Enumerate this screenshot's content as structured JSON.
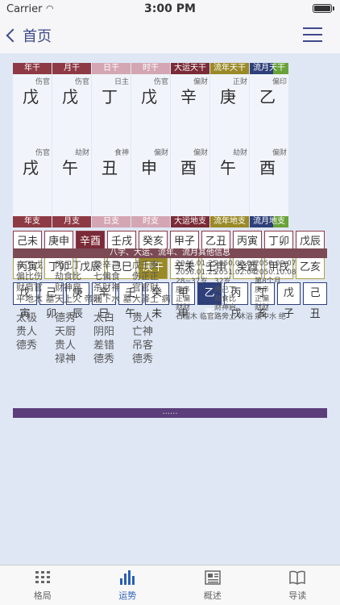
{
  "status": {
    "carrier": "Carrier",
    "time": "3:00 PM"
  },
  "nav": {
    "back_label": "首页"
  },
  "headers_top": [
    "年干",
    "月干",
    "日干",
    "时干",
    "大运天干",
    "流年天干",
    "流月天干"
  ],
  "headers_bottom": [
    "年支",
    "月支",
    "日支",
    "时支",
    "大运地支",
    "流年地支",
    "流月地支"
  ],
  "stems": [
    {
      "rel": "伤官",
      "char": "戊"
    },
    {
      "rel": "伤官",
      "char": "戊"
    },
    {
      "rel": "日主",
      "char": "丁"
    },
    {
      "rel": "伤官",
      "char": "戊"
    },
    {
      "rel": "偏财",
      "char": "辛"
    },
    {
      "rel": "正财",
      "char": "庚"
    },
    {
      "rel": "偏印",
      "char": "乙"
    }
  ],
  "branches": [
    {
      "rel": "伤官",
      "char": "戌"
    },
    {
      "rel": "劫财",
      "char": "午"
    },
    {
      "rel": "食神",
      "char": "丑"
    },
    {
      "rel": "偏财",
      "char": "申"
    },
    {
      "rel": "偏财",
      "char": "酉"
    },
    {
      "rel": "劫财",
      "char": "午"
    },
    {
      "rel": "偏财",
      "char": "酉"
    }
  ],
  "row1": [
    "己未",
    "庚申",
    "辛酉",
    "壬戌",
    "癸亥",
    "甲子",
    "乙丑",
    "丙寅",
    "丁卯",
    "戊辰"
  ],
  "row2": [
    "丙寅",
    "丁卯",
    "戊辰",
    "己巳",
    "庚午",
    "辛未",
    "壬申",
    "癸酉",
    "甲戌",
    "乙亥"
  ],
  "row3": [
    "戊寅",
    "己卯",
    "庚辰",
    "辛巳",
    "壬午",
    "癸未",
    "甲申",
    "乙酉",
    "丙戌",
    "丁亥",
    "戊子",
    "己丑"
  ],
  "section_title": "八字、大运、流年、流月其他信息",
  "info_cols": [
    {
      "lines": [
        "辛丁戊",
        "偏比伤",
        "财肩官",
        "平地木  墓"
      ],
      "extra": [
        "太极",
        "贵人",
        "德秀"
      ]
    },
    {
      "lines": [
        "丙己丁",
        "劫食比",
        "财神肩",
        "天上火  帝旺"
      ],
      "extra": [
        "德秀",
        "天厨",
        "贵人",
        "禄神"
      ]
    },
    {
      "lines": [
        "癸辛己",
        "七偏食",
        "杀财神",
        "涧下水  墓"
      ],
      "extra": [
        "太白",
        "阴阳",
        "差错",
        "德秀"
      ]
    },
    {
      "lines": [
        "戊壬庚",
        "伤正正",
        "官官财",
        "大驿土  病"
      ],
      "extra": [
        "贵人",
        "亡神",
        "吊客",
        "德秀"
      ]
    }
  ],
  "dayun": {
    "dates": [
      "2046.01.25",
      "2056.01.25"
    ],
    "age": "28~37岁",
    "stem": "庚辛",
    "rel": [
      "正偏",
      "财财"
    ],
    "nayin": "石榴木  临官"
  },
  "liunian": {
    "dates": [
      "2050.02.03",
      "2051.02.04"
    ],
    "age": "32岁",
    "stem": "丙己丁",
    "rel": [
      "劫食比",
      "财神肩"
    ],
    "nayin": "路旁土  沐浴"
  },
  "liuyue": {
    "dates": [
      "2050.09.07",
      "2050.10.08"
    ],
    "age": "第8个月",
    "stem": "庚辛",
    "rel": [
      "正偏",
      "财财"
    ],
    "nayin": "泉中水  绝"
  },
  "more": "......",
  "tabs": [
    "格局",
    "运势",
    "概述",
    "导读"
  ],
  "colors": {
    "year": "#8e3a45",
    "month": "#b1a040",
    "time": "#d69aa8",
    "dayun": "#7a2b37",
    "liunian": "#9a8a27",
    "liuyue": "#2e3f7a",
    "green": "#66a033"
  }
}
